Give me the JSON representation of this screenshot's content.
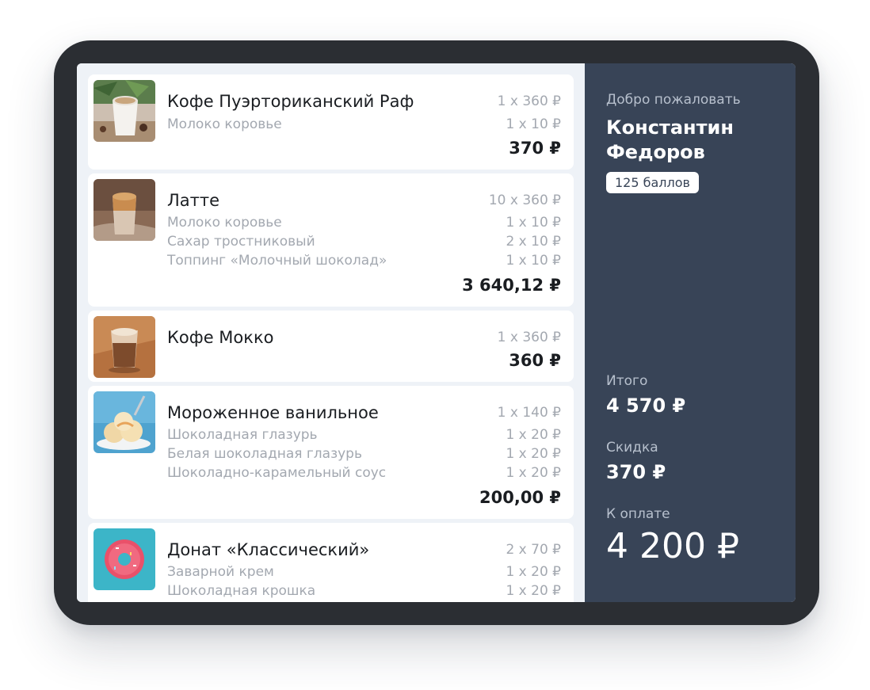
{
  "order": {
    "items": [
      {
        "name": "Кофе Пуэрториканский Раф",
        "qty": "1 x 360 ₽",
        "image": "raf-coffee-cup-photo",
        "modifiers": [
          {
            "name": "Молоко коровье",
            "qty": "1 x 10 ₽"
          }
        ],
        "total": "370 ₽"
      },
      {
        "name": "Латте",
        "qty": "10 x 360 ₽",
        "image": "latte-glass-photo",
        "modifiers": [
          {
            "name": "Молоко коровье",
            "qty": "1 x 10 ₽"
          },
          {
            "name": "Сахар тростниковый",
            "qty": "2 x 10 ₽"
          },
          {
            "name": "Топпинг «Молочный шоколад»",
            "qty": "1 x 10 ₽"
          }
        ],
        "total": "3 640,12 ₽"
      },
      {
        "name": "Кофе Мокко",
        "qty": "1 x 360 ₽",
        "image": "mocha-glass-photo",
        "modifiers": [],
        "total": "360 ₽"
      },
      {
        "name": "Мороженное ванильное",
        "qty": "1 x 140 ₽",
        "image": "vanilla-ice-cream-photo",
        "modifiers": [
          {
            "name": "Шоколадная глазурь",
            "qty": "1 x 20 ₽"
          },
          {
            "name": "Белая шоколадная глазурь",
            "qty": "1 x 20 ₽"
          },
          {
            "name": "Шоколадно-карамельный соус",
            "qty": "1 x 20 ₽"
          }
        ],
        "total": "200,00 ₽"
      },
      {
        "name": "Донат «Классический»",
        "qty": "2 x 70 ₽",
        "image": "donut-photo",
        "modifiers": [
          {
            "name": "Заварной крем",
            "qty": "1 x 20 ₽"
          },
          {
            "name": "Шоколадная крошка",
            "qty": "1 x 20 ₽"
          }
        ],
        "total": ""
      }
    ]
  },
  "sidebar": {
    "welcome": "Добро пожаловать",
    "customer_name": "Константин Федоров",
    "points": "125 баллов",
    "subtotal_label": "Итого",
    "subtotal_value": "4 570 ₽",
    "discount_label": "Скидка",
    "discount_value": "370 ₽",
    "pay_label": "К оплате",
    "pay_value": "4 200 ₽"
  },
  "colors": {
    "device_frame": "#2b2e33",
    "list_background": "#eef2f7",
    "sidebar_background": "#384457",
    "muted_text": "#a3a8b0",
    "primary_text": "#1a1d21"
  }
}
